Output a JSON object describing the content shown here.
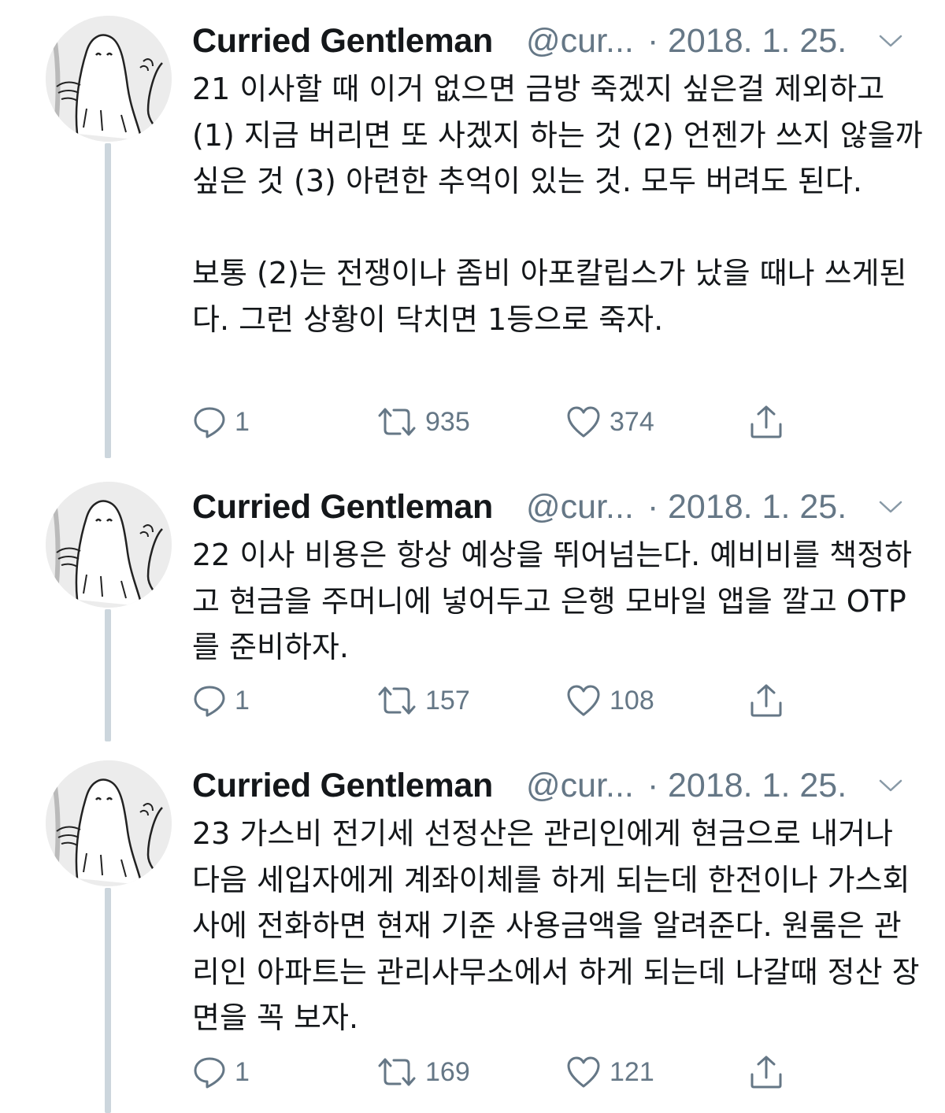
{
  "tweets": [
    {
      "author": "Curried Gentleman",
      "handle": "@cur...",
      "separator": "·",
      "date": "2018. 1. 25.",
      "text": "21 이사할 때 이거 없으면 금방 죽겠지 싶은걸 제외하고 (1) 지금 버리면 또 사겠지 하는 것 (2) 언젠가 쓰지 않을까 싶은 것 (3) 아련한 추억이 있는 것. 모두 버려도 된다.\n\n보통 (2)는 전쟁이나 좀비 아포칼립스가 났을 때나 쓰게된다. 그런 상황이 닥치면 1등으로 죽자.",
      "replies": "1",
      "retweets": "935",
      "likes": "374"
    },
    {
      "author": "Curried Gentleman",
      "handle": "@cur...",
      "separator": "·",
      "date": "2018. 1. 25.",
      "text": "22 이사 비용은 항상 예상을 뛰어넘는다. 예비비를 책정하고 현금을 주머니에 넣어두고 은행 모바일 앱을 깔고 OTP를 준비하자.",
      "replies": "1",
      "retweets": "157",
      "likes": "108"
    },
    {
      "author": "Curried Gentleman",
      "handle": "@cur...",
      "separator": "·",
      "date": "2018. 1. 25.",
      "text": "23 가스비 전기세 선정산은 관리인에게 현금으로 내거나 다음 세입자에게 계좌이체를 하게 되는데 한전이나 가스회사에 전화하면 현재 기준 사용금액을 알려준다. 원룸은 관리인 아파트는 관리사무소에서 하게 되는데 나갈때 정산 장면을 꼭 보자.",
      "replies": "1",
      "retweets": "169",
      "likes": "121"
    }
  ],
  "icons": {
    "reply": "reply-icon",
    "retweet": "retweet-icon",
    "like": "like-icon",
    "share": "share-icon",
    "more": "chevron-down-icon"
  },
  "colors": {
    "text": "#14171a",
    "secondary": "#657786",
    "thread_line": "#ccd6dd",
    "background": "#ffffff"
  }
}
